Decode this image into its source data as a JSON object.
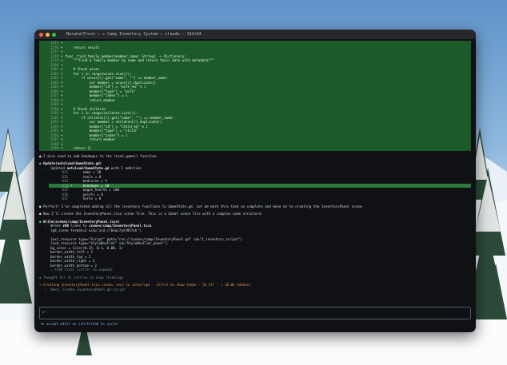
{
  "window": {
    "title": "NarwhalFrost — ✳ Camp Inventory System — claude — 192×64"
  },
  "code_block": [
    {
      "n": "1275",
      "t": "+",
      "code": "",
      "hl": false
    },
    {
      "n": "1276",
      "t": "+",
      "code": "    return result",
      "hl": false
    },
    {
      "n": "1277",
      "t": "+",
      "code": "",
      "hl": false
    },
    {
      "n": "1278",
      "t": "+",
      "code": "func _find_family_member(member_name: String) -> Dictionary:",
      "hl": false
    },
    {
      "n": "1279",
      "t": "+",
      "code": "    \"\"\"Find a family member by name and return their data with metadata\"\"\"",
      "hl": false
    },
    {
      "n": "1280",
      "t": "+",
      "code": "",
      "hl": false
    },
    {
      "n": "1281",
      "t": "+",
      "code": "    # Check wives",
      "hl": false
    },
    {
      "n": "1282",
      "t": "+",
      "code": "    for i in range(wives.size()):",
      "hl": false
    },
    {
      "n": "1283",
      "t": "+",
      "code": "        if wives[i].get(\"name\", \"\") == member_name:",
      "hl": false
    },
    {
      "n": "1284",
      "t": "+",
      "code": "            var member = wives[i].duplicate()",
      "hl": false
    },
    {
      "n": "1285",
      "t": "+",
      "code": "            member[\"id\"] = \"wife_%d\" % i",
      "hl": false
    },
    {
      "n": "1286",
      "t": "+",
      "code": "            member[\"type\"] = \"wife\"",
      "hl": false
    },
    {
      "n": "1287",
      "t": "+",
      "code": "            member[\"index\"] = i",
      "hl": false
    },
    {
      "n": "1288",
      "t": "+",
      "code": "            return member",
      "hl": false
    },
    {
      "n": "1289",
      "t": "+",
      "code": "",
      "hl": false
    },
    {
      "n": "1290",
      "t": "+",
      "code": "    # Check children",
      "hl": false
    },
    {
      "n": "1291",
      "t": "+",
      "code": "    for i in range(children.size()):",
      "hl": false
    },
    {
      "n": "1292",
      "t": "+",
      "code": "        if children[i].get(\"name\", \"\") == member_name:",
      "hl": false
    },
    {
      "n": "1293",
      "t": "+",
      "code": "            var member = children[i].duplicate()",
      "hl": false
    },
    {
      "n": "1294",
      "t": "+",
      "code": "            member[\"id\"] = \"child_%d\" % i",
      "hl": false
    },
    {
      "n": "1295",
      "t": "+",
      "code": "            member[\"type\"] = \"child\"",
      "hl": false
    },
    {
      "n": "1296",
      "t": "+",
      "code": "            member[\"index\"] = i",
      "hl": false
    },
    {
      "n": "1297",
      "t": "+",
      "code": "            return member",
      "hl": false
    },
    {
      "n": "1298",
      "t": "+",
      "code": "",
      "hl": false
    },
    {
      "n": "1299",
      "t": "+",
      "code": "    return {}",
      "hl": false
    }
  ],
  "msg1": "I also need to add bandages to the reset_game() function:",
  "update_call": "Update(autoload/GameState.gd)",
  "update_result_prefix": "Updated ",
  "update_result_file": "autoload/GameState.gd",
  "update_result_suffix": " with 1 addition",
  "update_lines": [
    {
      "n": "611",
      "t": " ",
      "code": "    ammo = 20",
      "hl": false
    },
    {
      "n": "612",
      "t": " ",
      "code": "    tools = 0",
      "hl": false
    },
    {
      "n": "613",
      "t": " ",
      "code": "    medicine = 5",
      "hl": false
    },
    {
      "n": "614",
      "t": "+",
      "code": "    bandages = 10",
      "hl": true
    },
    {
      "n": "615",
      "t": " ",
      "code": "    wagon_health = 100",
      "hl": false
    },
    {
      "n": "616",
      "t": " ",
      "code": "    points = 0",
      "hl": false
    },
    {
      "n": "617",
      "t": " ",
      "code": "    horns = 0",
      "hl": false
    }
  ],
  "msg2": "Perfect! I've completed adding all the inventory functions to GameState.gd. Let me mark this task as complete and move on to creating the InventoryPanel scene.",
  "msg3": "Now I'll create the InventoryPanel.tscn scene file. This is a Godot scene file with a complex node structure:",
  "write_call": "Write(scenes/camp/InventoryPanel.tscn)",
  "write_result_prefix": "Wrote ",
  "write_result_count": "200",
  "write_result_mid": " lines to ",
  "write_result_file": "scenes/camp/InventoryPanel.tscn",
  "write_lines": [
    "[gd_scene format=3 uid=\"uid://bkqc7yxf8h7xh\"]",
    "",
    "[ext_resource type=\"Script\" path=\"res://scenes/camp/InventoryPanel.gd\" id=\"1_inventory_script\"]",
    "[sub_resource type=\"StyleBoxFlat\" id=\"StyleBoxFlat_panel\"]",
    "bg_color = Color(0.15, 0.1, 0.08, 1)",
    "border_width_left = 2",
    "border_width_top = 2",
    "border_width_right = 2",
    "border_width_bottom = 2"
  ],
  "write_more": "… +190 lines (ctrl+r to expand)",
  "thought": "Thought for 3s (ctrl+o to show thinking)",
  "status_line": "Creating InventoryPanel.tscn scene… (esc to interrupt · ctrl+t to show todos · 5k tfr · ↓ 10.0k tokens)",
  "todo_next": "Next: Create InventoryPanel.gd script",
  "input_prompt": ">",
  "footer": "⏵⏵ accept edits on (shift+tab to cycle)"
}
